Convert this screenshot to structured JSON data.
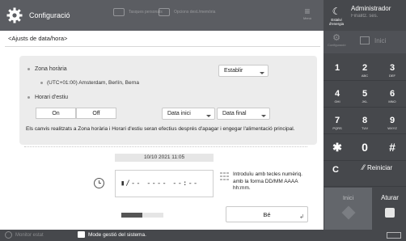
{
  "header": {
    "title": "Configuració",
    "ghost_items": [
      "Tasques personals",
      "Opcions dest./memòria"
    ],
    "menu_label": "Menú",
    "energy_label": "Estalvi d'energia",
    "admin_name": "Administrador",
    "logout_label": "Finalitz. ses."
  },
  "page": {
    "title": "<Ajusts de data/hora>",
    "timezone_label": "Zona horària",
    "timezone_value": "(UTC+01:00) Amsterdam, Berlín, Berna",
    "set_label": "Establir",
    "dst_label": "Horari d'estiu",
    "on_label": "On",
    "off_label": "Off",
    "start_date_label": "Data inici",
    "end_date_label": "Data final",
    "notice": "Els canvis realitzats a Zona horària i Horari d'estiu seran efectius després d'apagar i engegar l'alimentació principal.",
    "current_datetime": "10/10 2021 11:05",
    "entry_value": "▮/-- ---- --:--",
    "hint": "Introduïu amb tecles numèriq. amb la forma DD/MM AAAA hh:mm.",
    "ok_label": "Bé",
    "progress": 0.5
  },
  "rightpanel": {
    "config_label": "Configuració",
    "home_label": "Inici",
    "keys": [
      {
        "n": "1",
        "s": ""
      },
      {
        "n": "2",
        "s": "ABC"
      },
      {
        "n": "3",
        "s": "DEF"
      },
      {
        "n": "4",
        "s": "GHI"
      },
      {
        "n": "5",
        "s": "JKL"
      },
      {
        "n": "6",
        "s": "MNO"
      },
      {
        "n": "7",
        "s": "PQRS"
      },
      {
        "n": "8",
        "s": "TUV"
      },
      {
        "n": "9",
        "s": "WXYZ"
      },
      {
        "n": "✱",
        "s": ""
      },
      {
        "n": "0",
        "s": ""
      },
      {
        "n": "#",
        "s": ""
      }
    ],
    "clear_label": "C",
    "reset_label": "Reiniciar",
    "start_label": "Inici",
    "stop_label": "Aturar"
  },
  "footer": {
    "monitor_label": "Monitor estat",
    "mode_label": "Mode gestió del sistema."
  }
}
